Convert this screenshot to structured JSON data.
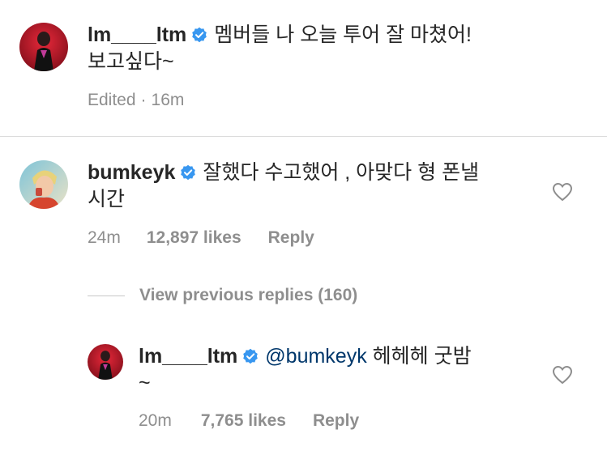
{
  "caption": {
    "username": "lm____ltm",
    "text_line1": "멤버들 나 오늘 투어 잘 마쳤어!",
    "text_line2": "보고싶다~",
    "edited_label": "Edited",
    "separator": "·",
    "time": "16m"
  },
  "comments": [
    {
      "username": "bumkeyk",
      "text_line1": "잘했다 수고했어 , 아맞다 형 폰낼",
      "text_line2": "시간",
      "time": "24m",
      "likes": "12,897 likes",
      "reply_label": "Reply"
    }
  ],
  "view_previous": "View previous replies (160)",
  "reply": {
    "username": "lm____ltm",
    "mention": "@bumkeyk",
    "text_line1": "헤헤헤 굿밤",
    "text_line2": "~",
    "time": "20m",
    "likes": "7,765 likes",
    "reply_label": "Reply"
  },
  "colors": {
    "verified_blue": "#3897f0",
    "meta_gray": "#8e8e8e",
    "mention_blue": "#00376b"
  },
  "icons": {
    "verified": "verified-badge-icon",
    "heart": "heart-outline-icon"
  }
}
